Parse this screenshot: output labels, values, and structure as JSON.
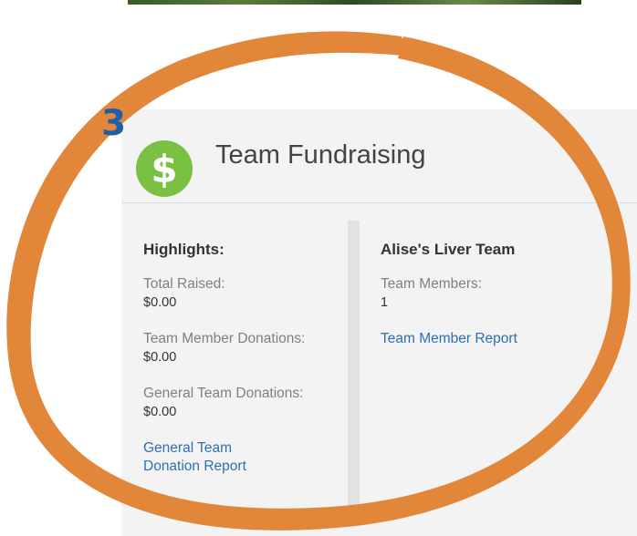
{
  "step_number": "3",
  "panel": {
    "title": "Team Fundraising",
    "icon": "dollar-icon",
    "icon_glyph": "$",
    "highlights": {
      "heading": "Highlights:",
      "stats": [
        {
          "label": "Total Raised:",
          "value": "$0.00"
        },
        {
          "label": "Team Member Donations:",
          "value": "$0.00"
        },
        {
          "label": "General Team Donations:",
          "value": "$0.00"
        }
      ],
      "link_line1": "General Team",
      "link_line2": "Donation Report"
    },
    "team": {
      "heading": "Alise's Liver Team",
      "members_label": "Team Members:",
      "members_value": "1",
      "report_link": "Team Member Report"
    }
  },
  "colors": {
    "accent_green": "#7ac143",
    "link_blue": "#2f6eb5",
    "swirl_orange": "#e07f2f",
    "step_blue": "#1f5fa8"
  }
}
